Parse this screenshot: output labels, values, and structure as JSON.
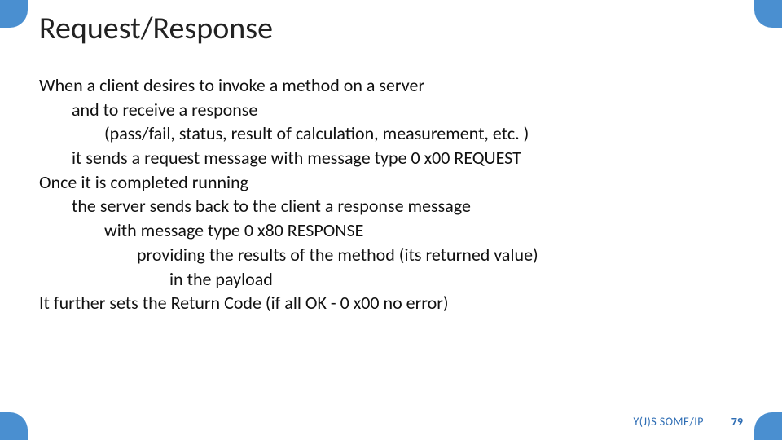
{
  "title": "Request/Response",
  "lines": {
    "l0": "When a client desires to invoke a method on a server",
    "l1": "and to receive a response",
    "l2": "(pass/fail, status, result of calculation, measurement, etc. )",
    "l3": "it sends a request message with message type 0 x00 REQUEST",
    "l4": "Once it is completed running",
    "l5": "the server sends back to the client a response message",
    "l6": "with message type 0 x80 RESPONSE",
    "l7": "providing the results of the method (its returned value)",
    "l8": "in the payload",
    "l9": "It further sets the Return Code (if all OK - 0 x00 no error)"
  },
  "footer": {
    "label": "Y(J)S  SOME/IP",
    "page": "79"
  },
  "accent_color": "#4a8fd0"
}
